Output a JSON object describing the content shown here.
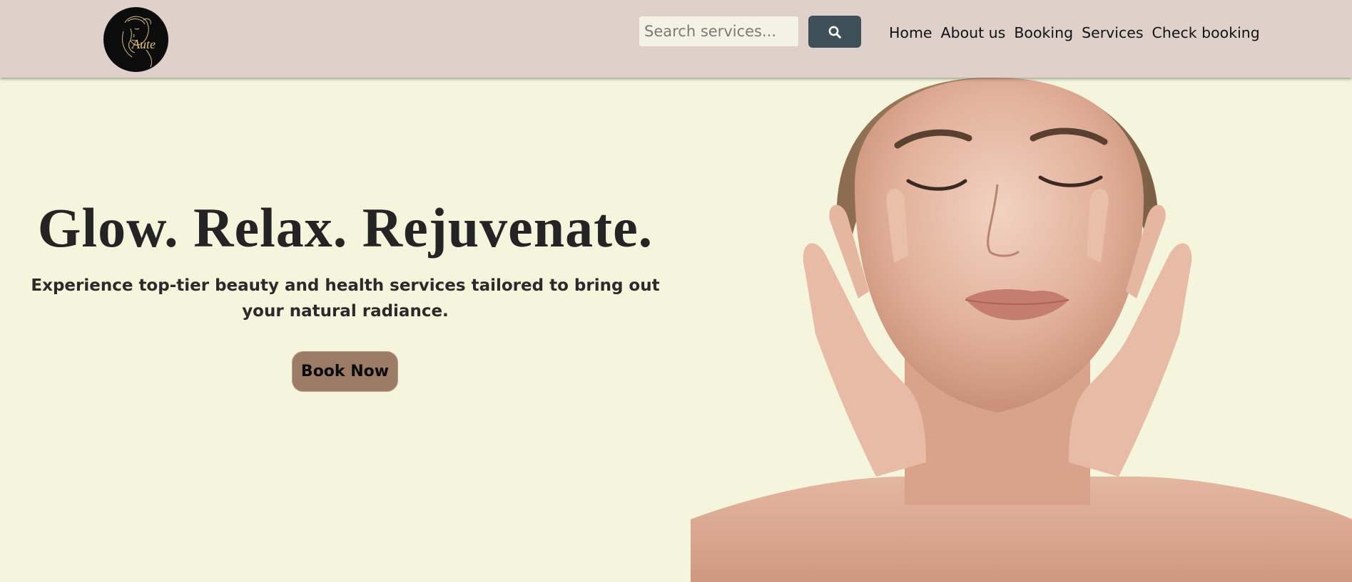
{
  "header": {
    "logo": {
      "text": "Aute",
      "icon": "woman-portrait-logo"
    },
    "search": {
      "placeholder": "Search services...",
      "value": "",
      "icon": "search-icon"
    },
    "nav": [
      "Home",
      "About us",
      "Booking",
      "Services",
      "Check booking"
    ]
  },
  "hero": {
    "title": "Glow. Relax. Rejuvenate.",
    "subtitle": "Experience top-tier beauty and health services tailored to bring out your natural radiance.",
    "cta_label": "Book Now",
    "image": "woman-face-with-hands-photo"
  },
  "colors": {
    "header_bg": "#dfd0c9",
    "page_bg": "#f5f4dc",
    "search_button": "#3f4f59",
    "cta_button": "#9c7c67"
  }
}
